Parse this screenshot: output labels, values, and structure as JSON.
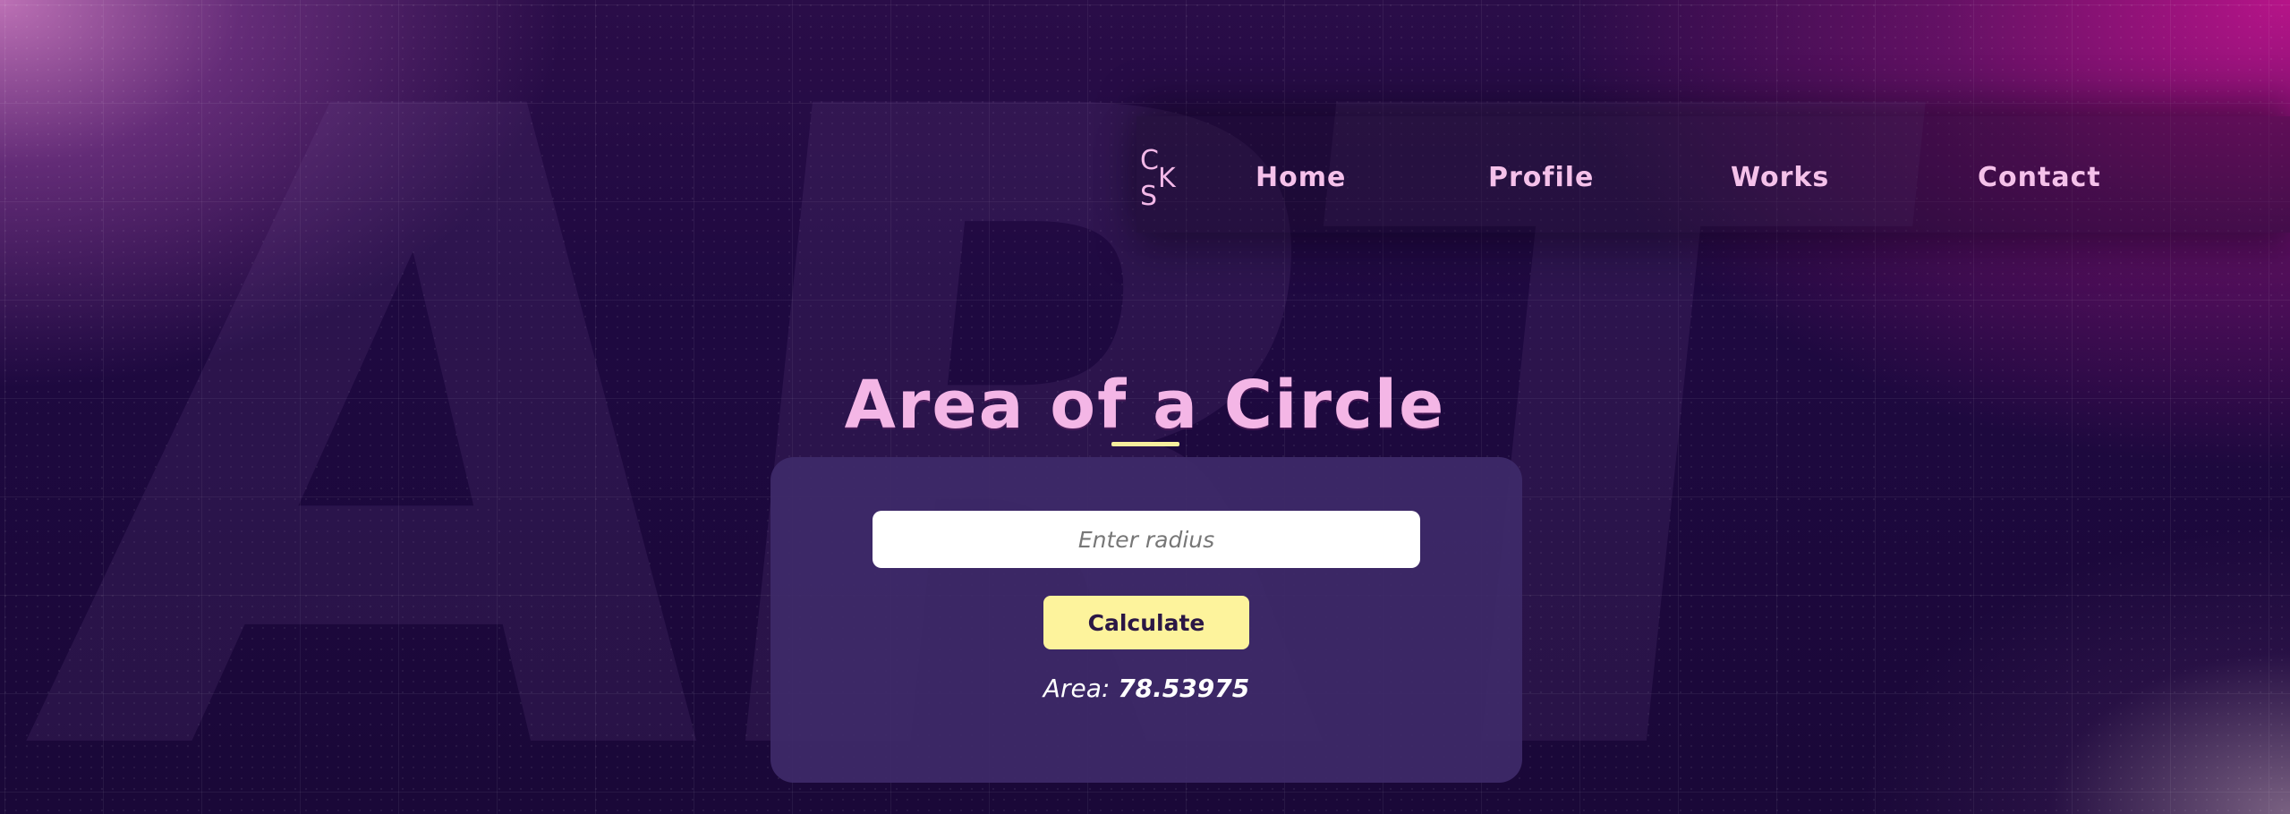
{
  "nav": {
    "logo_text": "CSK",
    "links": [
      {
        "label": "Home"
      },
      {
        "label": "Profile"
      },
      {
        "label": "Works"
      },
      {
        "label": "Contact"
      }
    ]
  },
  "main": {
    "title": "Area of a Circle",
    "input_placeholder": "Enter radius",
    "input_value": "",
    "button_label": "Calculate",
    "result_label": "Area:",
    "result_value": "78.53975"
  },
  "colors": {
    "accent_pink": "#f4b6e6",
    "button_yellow": "#fdf39c",
    "card_purple": "#3e2a69",
    "background_dark": "#1a0838",
    "background_magenta": "#be148c"
  },
  "background": {
    "ghost_text": "ART"
  }
}
